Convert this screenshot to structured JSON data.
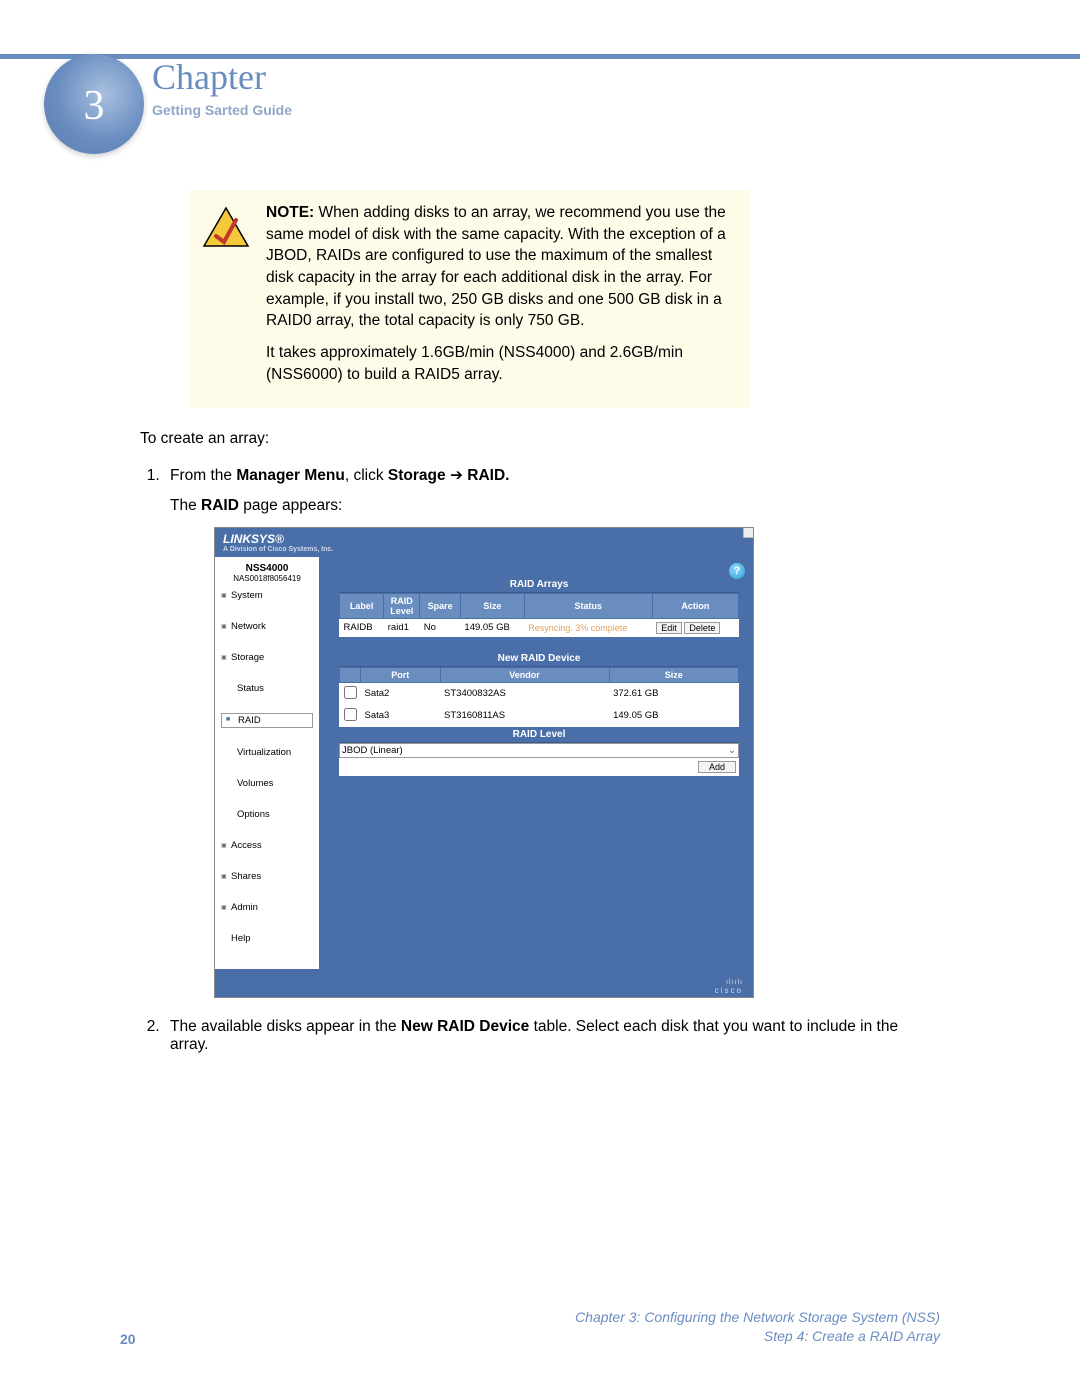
{
  "header": {
    "chapter_word": "Chapter",
    "chapter_num": "3",
    "subtitle": "Getting Sarted Guide"
  },
  "note": {
    "label": "NOTE:",
    "p1": " When adding disks to an array, we recommend you use the same model of disk with the same capacity. With the exception of a JBOD, RAIDs are configured to use the maximum of the smallest disk capacity in the array for each additional disk in the array. For example, if you install two, 250 GB disks and one 500 GB disk in a RAID0 array, the total capacity is only 750 GB.",
    "p2": "It takes approximately 1.6GB/min (NSS4000) and 2.6GB/min (NSS6000) to build a RAID5 array."
  },
  "body": {
    "intro": "To create an array:",
    "step1_a": "From the ",
    "step1_b": "Manager Menu",
    "step1_c": ", click ",
    "step1_d": "Storage",
    "step1_e": "RAID.",
    "step1_sub_a": "The ",
    "step1_sub_b": "RAID",
    "step1_sub_c": " page appears:",
    "step2_a": "The available disks appear in the ",
    "step2_b": "New RAID Device",
    "step2_c": " table. Select each disk that you want to include in the array."
  },
  "screenshot": {
    "brand": "LINKSYS®",
    "brand_sub": "A Division of Cisco Systems, Inc.",
    "device": "NSS4000",
    "device_id": "NAS0018f8056419",
    "nav": {
      "system": "System",
      "network": "Network",
      "storage": "Storage",
      "status": "Status",
      "raid": "RAID",
      "virtualization": "Virtualization",
      "volumes": "Volumes",
      "options": "Options",
      "access": "Access",
      "shares": "Shares",
      "admin": "Admin",
      "help": "Help"
    },
    "help_icon": "?",
    "arrays": {
      "title": "RAID Arrays",
      "h_label": "Label",
      "h_level": "RAID Level",
      "h_spare": "Spare",
      "h_size": "Size",
      "h_status": "Status",
      "h_action": "Action",
      "row": {
        "label": "RAIDB",
        "level": "raid1",
        "spare": "No",
        "size": "149.05 GB",
        "status": "Resyncing. 3% complete",
        "edit": "Edit",
        "delete": "Delete"
      }
    },
    "newdev": {
      "title": "New RAID Device",
      "h_port": "Port",
      "h_vendor": "Vendor",
      "h_size": "Size",
      "rows": [
        {
          "port": "Sata2",
          "vendor": "ST3400832AS",
          "size": "372.61 GB"
        },
        {
          "port": "Sata3",
          "vendor": "ST3160811AS",
          "size": "149.05 GB"
        }
      ],
      "level_title": "RAID Level",
      "level_value": "JBOD (Linear)",
      "add": "Add"
    },
    "footer_brand": "cisco"
  },
  "footer": {
    "page": "20",
    "line1": "Chapter 3: Configuring the Network Storage System (NSS)",
    "line2": "Step 4: Create a RAID Array"
  }
}
